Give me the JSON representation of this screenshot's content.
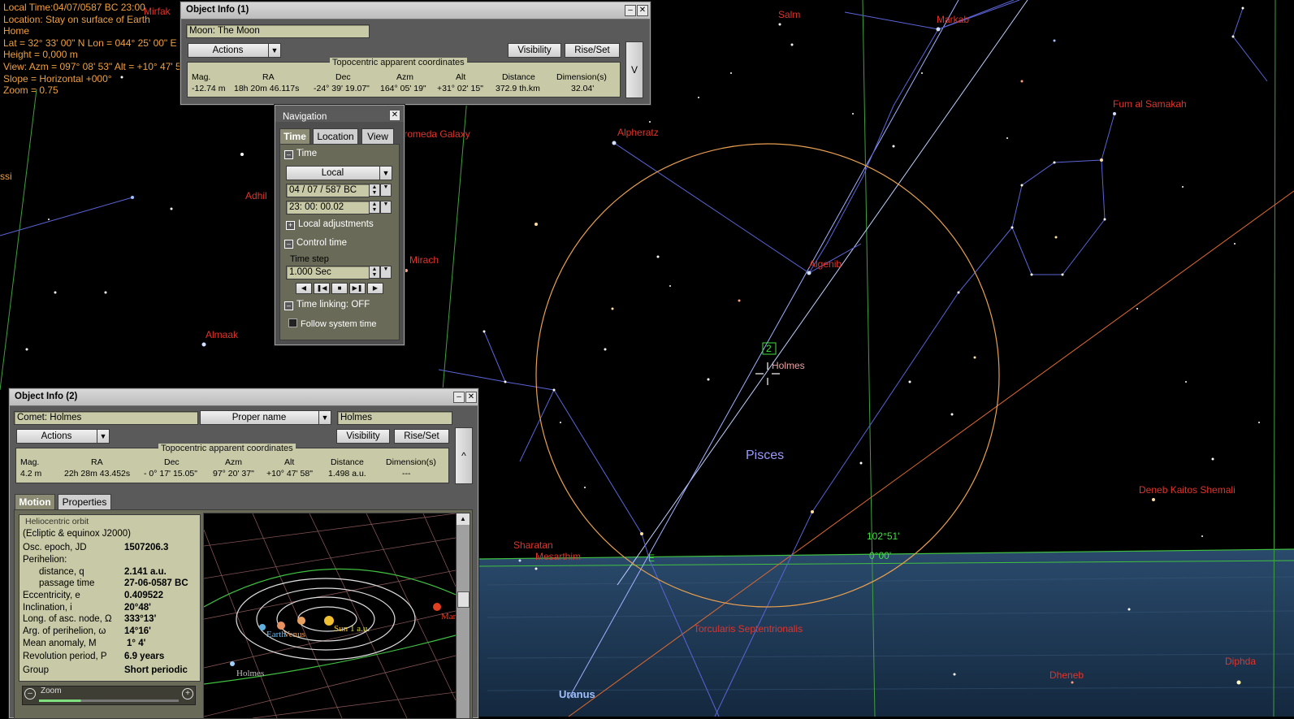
{
  "hud": {
    "lines": [
      "Local Time:04/07/0587 BC 23:00",
      "Location: Stay on surface of Earth",
      "Home",
      "Lat = 32° 33' 00\" N   Lon = 044° 25' 00\" E",
      "Height = 0,000 m",
      "View: Azm = 097° 08' 53\"  Alt = +10° 47' 58\"",
      "Slope = Horizontal +000°",
      "Zoom = 0.75"
    ]
  },
  "sky": {
    "labels": {
      "salm": "Salm",
      "markab": "Markab",
      "fum": "Fum al Samakah",
      "alpheratz": "Alpheratz",
      "algenib": "Algenib",
      "andromeda": "Andromeda Galaxy",
      "adhil": "Adhil",
      "mirach": "Mirach",
      "almaak": "Almaak",
      "holmes": "Holmes",
      "pisces": "Pisces",
      "deneb_kaitos": "Deneb Kaitos Shemali",
      "sharatan": "Sharatan",
      "mesarthim": "Mesarthim",
      "torcularis": "Torcularis Septentrionalis",
      "dheneb": "Dheneb",
      "diphda": "Diphda",
      "uranus": "Uranus",
      "mirfak": "Mirfak",
      "alt_deg": "102°51'",
      "alt_zero": "0°00'",
      "east": "E",
      "marker": "2",
      "left_frag": "ssi"
    }
  },
  "info1": {
    "title": "Object Info (1)",
    "object": "Moon: The Moon",
    "actions": "Actions",
    "visibility": "Visibility",
    "riseset": "Rise/Set",
    "coords_title": "Topocentric apparent coordinates",
    "headers": [
      "Mag.",
      "RA",
      "Dec",
      "Azm",
      "Alt",
      "Distance",
      "Dimension(s)"
    ],
    "values": [
      "-12.74 m",
      "18h 20m 46.117s",
      "-24° 39' 19.07\"",
      "164° 05' 19\"",
      "+31° 02' 15\"",
      "372.9 th.km",
      "32.04'"
    ],
    "expand": "V"
  },
  "nav": {
    "title": "Navigation",
    "tabs": [
      "Time",
      "Location",
      "View"
    ],
    "time_section": "Time",
    "time_mode": "Local",
    "date_value": "04 / 07 / 587   BC",
    "time_value": "23:  00: 00.02",
    "local_adj": "Local adjustments",
    "control_section": "Control time",
    "time_step_label": "Time step",
    "time_step_value": "1.000      Sec",
    "linking": "Time linking: OFF",
    "follow": "Follow system time"
  },
  "info2": {
    "title": "Object Info (2)",
    "object": "Comet: Holmes",
    "name_type": "Proper name",
    "name_value": "Holmes",
    "actions": "Actions",
    "visibility": "Visibility",
    "riseset": "Rise/Set",
    "coords_title": "Topocentric apparent coordinates",
    "headers": [
      "Mag.",
      "RA",
      "Dec",
      "Azm",
      "Alt",
      "Distance",
      "Dimension(s)"
    ],
    "values": [
      "4.2 m",
      "22h 28m 43.452s",
      "- 0° 17' 15.05\"",
      "97° 20' 37\"",
      "+10° 47' 58\"",
      "1.498 a.u.",
      "---"
    ],
    "collapse": "^",
    "tabs": [
      "Motion",
      "Properties"
    ],
    "orbit_title": "Heliocentric orbit",
    "orbit_sub": "(Ecliptic & equinox J2000)",
    "orbit": [
      {
        "label": "Osc. epoch, JD",
        "value": "1507206.3"
      },
      {
        "label": "Perihelion:",
        "value": ""
      },
      {
        "label": "distance, q",
        "value": "2.141 a.u."
      },
      {
        "label": "passage time",
        "value": "27-06-0587 BC"
      },
      {
        "label": "Eccentricity, e",
        "value": "0.409522"
      },
      {
        "label": "Inclination, i",
        "value": "20°48'"
      },
      {
        "label": "Long. of asc. node, Ω",
        "value": "333°13'"
      },
      {
        "label": "Arg. of perihelion, ω",
        "value": "14°16'"
      },
      {
        "label": "Mean anomaly, M",
        "value": "1° 4'"
      },
      {
        "label": "Revolution period, P",
        "value": "6.9 years"
      },
      {
        "label": "Group",
        "value": "Short periodic"
      }
    ],
    "zoom": "Zoom",
    "orbit_labels": {
      "earth": "Earth",
      "venus": "Venus",
      "sun": "Sun",
      "au": "1 a.u.",
      "mars": "Mars",
      "holmes": "Holmes"
    }
  },
  "colors": {
    "sky": "#000000",
    "label": "#e0342c",
    "hud": "#f0a040",
    "panel": "#c8c9a6",
    "sea": "#1d3550"
  }
}
